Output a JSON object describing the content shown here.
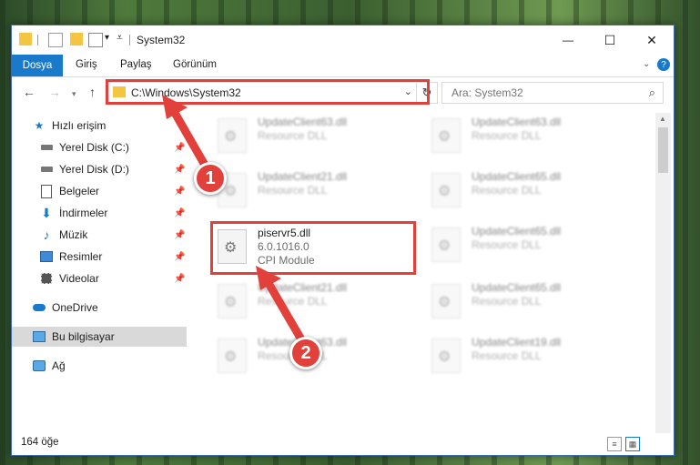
{
  "window": {
    "title": "System32",
    "controls": {
      "minimize": "—",
      "maximize": "☐",
      "close": "✕"
    }
  },
  "ribbon": {
    "file_tab": "Dosya",
    "tabs": [
      "Giriş",
      "Paylaş",
      "Görünüm"
    ],
    "help": "?"
  },
  "nav": {
    "address": "C:\\Windows\\System32",
    "search_placeholder": "Ara: System32"
  },
  "sidebar": {
    "items": [
      {
        "label": "Hızlı erişim",
        "icon": "star-icon"
      },
      {
        "label": "Yerel Disk (C:)",
        "icon": "drive-icon",
        "pinned": true
      },
      {
        "label": "Yerel Disk (D:)",
        "icon": "drive-icon",
        "pinned": true
      },
      {
        "label": "Belgeler",
        "icon": "document-icon",
        "pinned": true
      },
      {
        "label": "İndirmeler",
        "icon": "download-icon",
        "pinned": true
      },
      {
        "label": "Müzik",
        "icon": "music-icon",
        "pinned": true
      },
      {
        "label": "Resimler",
        "icon": "pictures-icon",
        "pinned": true
      },
      {
        "label": "Videolar",
        "icon": "video-icon",
        "pinned": true
      },
      {
        "label": "OneDrive",
        "icon": "cloud-icon"
      },
      {
        "label": "Bu bilgisayar",
        "icon": "computer-icon",
        "selected": true
      },
      {
        "label": "Ağ",
        "icon": "network-icon"
      }
    ]
  },
  "files": [
    {
      "name": "UpdateClient63.dll",
      "line1": "Resource DLL",
      "line2": "",
      "blurred": true
    },
    {
      "name": "UpdateClient63.dll",
      "line1": "Resource DLL",
      "line2": "",
      "blurred": true
    },
    {
      "name": "UpdateClient21.dll",
      "line1": "Resource DLL",
      "line2": "",
      "blurred": true
    },
    {
      "name": "UpdateClient65.dll",
      "line1": "Resource DLL",
      "line2": "",
      "blurred": true
    },
    {
      "name": "piservr5.dll",
      "line1": "6.0.1016.0",
      "line2": "CPI Module",
      "blurred": false
    },
    {
      "name": "UpdateClient65.dll",
      "line1": "Resource DLL",
      "line2": "",
      "blurred": true
    },
    {
      "name": "UpdateClient21.dll",
      "line1": "Resource DLL",
      "line2": "",
      "blurred": true
    },
    {
      "name": "UpdateClient65.dll",
      "line1": "Resource DLL",
      "line2": "",
      "blurred": true
    },
    {
      "name": "UpdateClient63.dll",
      "line1": "Resource DLL",
      "line2": "",
      "blurred": true
    },
    {
      "name": "UpdateClient19.dll",
      "line1": "Resource DLL",
      "line2": "",
      "blurred": true
    }
  ],
  "status": {
    "item_count": "164 öğe"
  },
  "annotations": {
    "step1": "1",
    "step2": "2",
    "color": "#e2403a"
  }
}
